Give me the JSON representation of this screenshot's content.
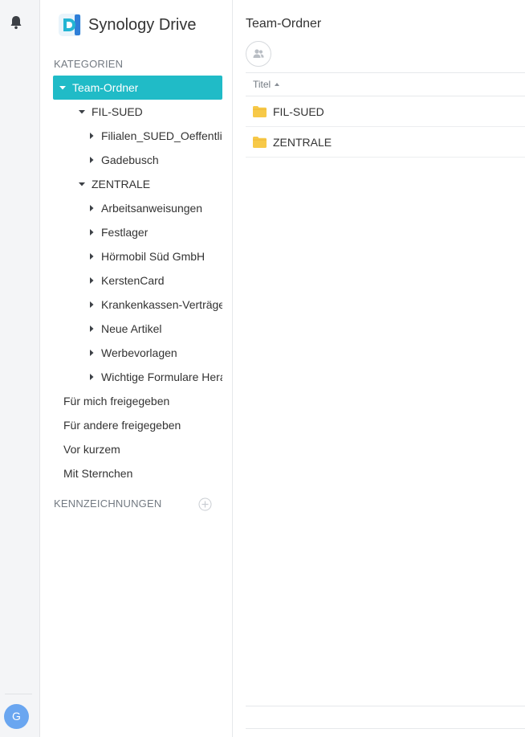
{
  "app": {
    "name": "Synology Drive"
  },
  "rail": {
    "avatar_initial": "G"
  },
  "sidebar": {
    "categories_label": "KATEGORIEN",
    "tags_label": "KENNZEICHNUNGEN",
    "tree": [
      {
        "label": "Team-Ordner",
        "level": 0,
        "expanded": true,
        "active": true
      },
      {
        "label": "FIL-SUED",
        "level": 1,
        "expanded": true
      },
      {
        "label": "Filialen_SUED_Oeffentlich",
        "level": 2,
        "expanded": false
      },
      {
        "label": "Gadebusch",
        "level": 2,
        "expanded": false
      },
      {
        "label": "ZENTRALE",
        "level": 1,
        "expanded": true
      },
      {
        "label": "Arbeitsanweisungen",
        "level": 2,
        "expanded": false
      },
      {
        "label": "Festlager",
        "level": 2,
        "expanded": false
      },
      {
        "label": "Hörmobil Süd GmbH",
        "level": 2,
        "expanded": false
      },
      {
        "label": "KerstenCard",
        "level": 2,
        "expanded": false
      },
      {
        "label": "Krankenkassen-Verträge",
        "level": 2,
        "expanded": false
      },
      {
        "label": "Neue Artikel",
        "level": 2,
        "expanded": false
      },
      {
        "label": "Werbevorlagen",
        "level": 2,
        "expanded": false
      },
      {
        "label": "Wichtige Formulare Herausgabe",
        "level": 2,
        "expanded": false
      }
    ],
    "nav": [
      "Für mich freigegeben",
      "Für andere freigegeben",
      "Vor kurzem",
      "Mit Sternchen"
    ]
  },
  "main": {
    "title": "Team-Ordner",
    "column_title": "Titel",
    "rows": [
      {
        "name": "FIL-SUED"
      },
      {
        "name": "ZENTRALE"
      }
    ]
  },
  "colors": {
    "accent": "#20bbc7",
    "folder": "#f7c948",
    "avatar": "#6aa6f0"
  }
}
